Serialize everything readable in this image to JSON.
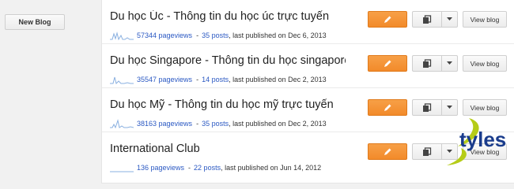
{
  "sidebar": {
    "new_blog_label": "New Blog"
  },
  "colors": {
    "accent": "#f28a2a",
    "link": "#2b59c3",
    "watermark": "#1a3c8c",
    "watermark_swoosh": "#b5cc18"
  },
  "icons": {
    "edit": "pencil-icon",
    "posts": "copy-icon",
    "dropdown": "caret-down-icon"
  },
  "blogs": [
    {
      "title": "Du học Úc - Thông tin du học úc trực tuyến",
      "pageviews": "57344 pageviews",
      "posts": "35 posts",
      "last_published": ", last published on Dec 6, 2013",
      "view_label": "View blog"
    },
    {
      "title": "Du học Singapore - Thông tin du học singapore t...",
      "pageviews": "35547 pageviews",
      "posts": "14 posts",
      "last_published": ", last published on Dec 2, 2013",
      "view_label": "View blog"
    },
    {
      "title": "Du học Mỹ - Thông tin du học mỹ trực tuyến",
      "pageviews": "38163 pageviews",
      "posts": "35 posts",
      "last_published": ", last published on Dec 2, 2013",
      "view_label": "View blog"
    },
    {
      "title": "International Club",
      "pageviews": "136 pageviews",
      "posts": "22 posts",
      "last_published": ", last published on Jun 14, 2012",
      "view_label": "View blog"
    }
  ],
  "watermark": {
    "text": "tyles"
  }
}
